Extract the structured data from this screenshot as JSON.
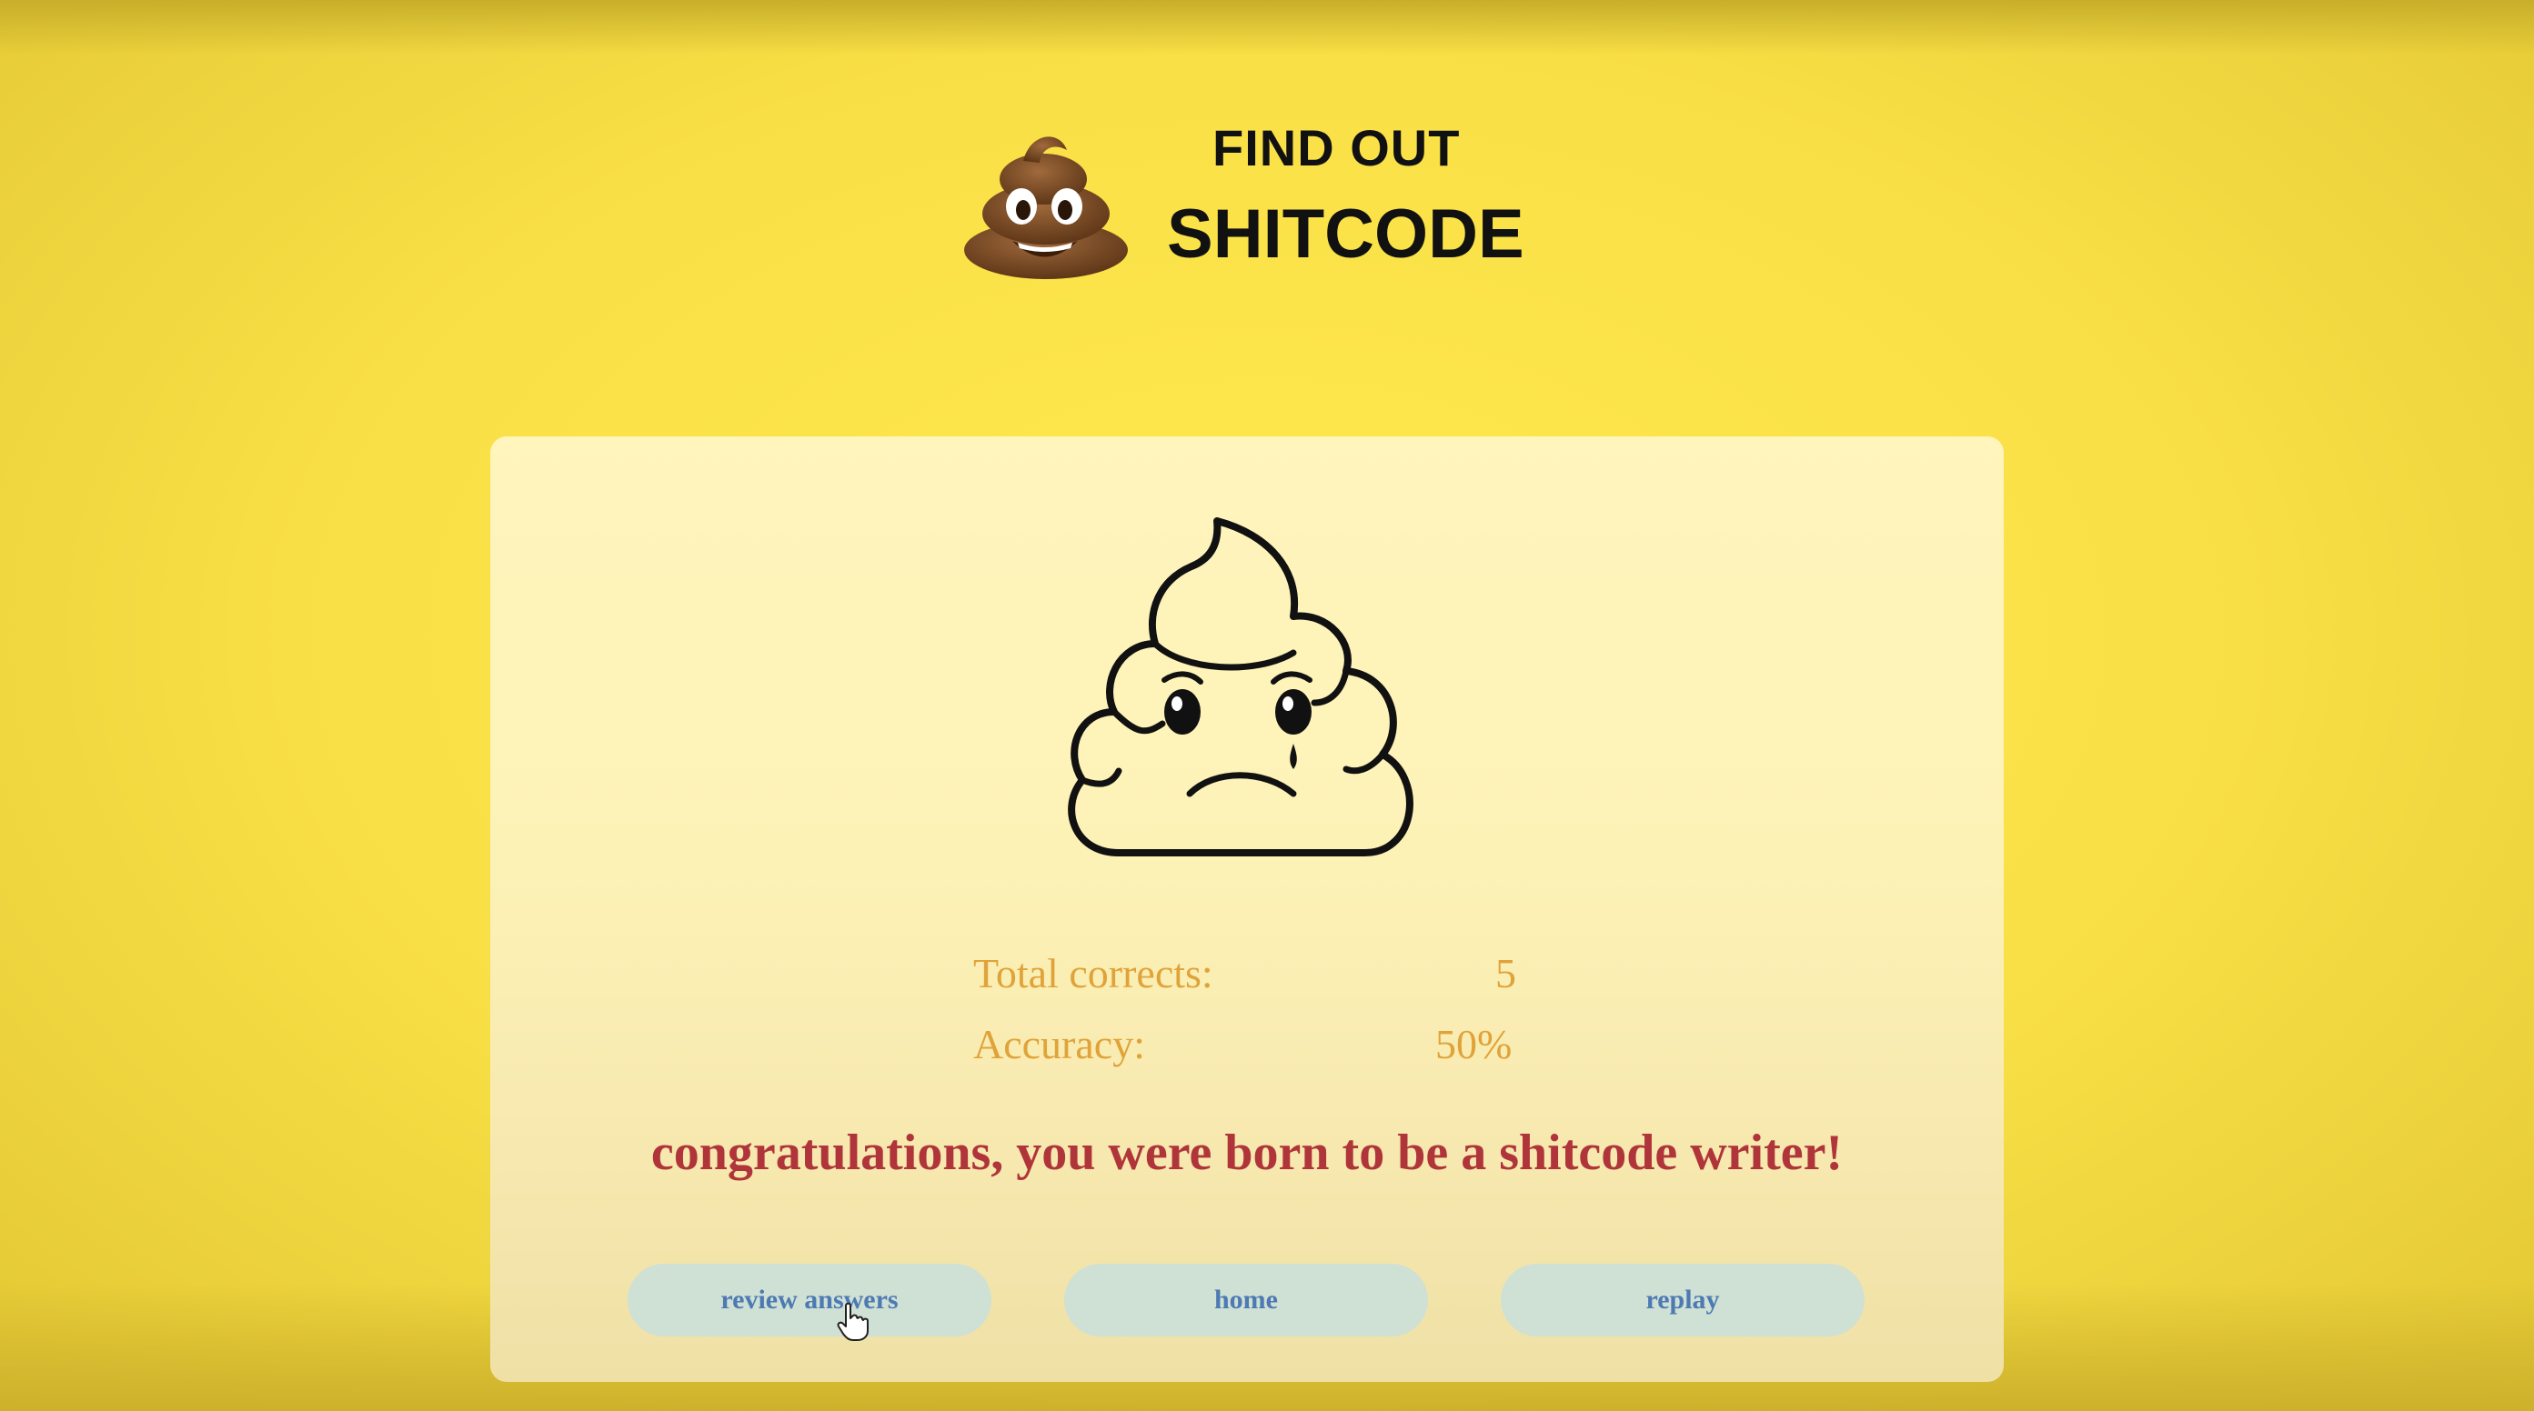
{
  "header": {
    "line1": "FIND OUT",
    "line2": "SHITCODE",
    "logo_icon": "pile-of-poo-emoji"
  },
  "result": {
    "mood_icon": "crying-poo-outline-icon",
    "stats": [
      {
        "label": "Total corrects:",
        "value": "5"
      },
      {
        "label": "Accuracy:",
        "value": "50%"
      }
    ],
    "message": "congratulations, you were born to be a shitcode writer!"
  },
  "buttons": {
    "review": "review answers",
    "home": "home",
    "replay": "replay"
  },
  "colors": {
    "background": "#f8df45",
    "card": "#fdf2b6",
    "stat_text": "#e0a33a",
    "message_text": "#b0353a",
    "button_bg": "#cfe0d4",
    "button_text": "#4d7ab3"
  }
}
